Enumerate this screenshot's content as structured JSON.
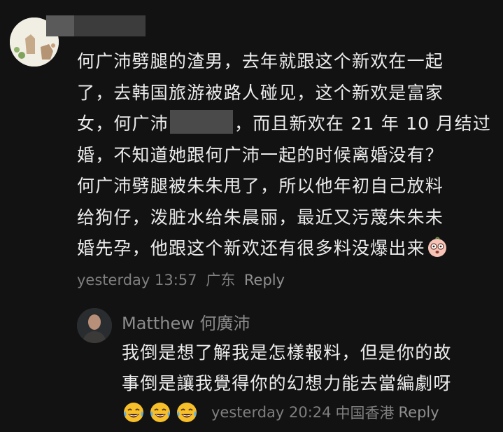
{
  "comment": {
    "lines": [
      "何广沛劈腿的渣男，去年就跟这个新欢在一起",
      "了，去韩国旅游被路人碰见，这个新欢是富家",
      "女，何广沛",
      "，而且新欢在 21 年 10 月结过",
      "婚，不知道她跟何广沛一起的时候离婚没有？",
      "何广沛劈腿被朱朱甩了，所以他年初自己放料",
      "给狗仔，泼脏水给朱晨丽，最近又污蔑朱朱未",
      "婚先孕，他跟这个新欢还有很多料没爆出来"
    ],
    "time": "yesterday 13:57",
    "location": "广东",
    "reply_label": "Reply",
    "emoji_end": "shocked-face-icon"
  },
  "reply": {
    "author": "Matthew 何廣沛",
    "lines": [
      "我倒是想了解我是怎樣報料，但是你的故",
      "事倒是讓我覺得你的幻想力能去當編劇呀"
    ],
    "emojis": [
      "tears-of-joy-icon",
      "tears-of-joy-icon",
      "tears-of-joy-icon"
    ],
    "time": "yesterday 20:24",
    "location": "中国香港",
    "reply_label": "Reply"
  },
  "colors": {
    "background": "#121212",
    "text": "#ececec",
    "meta": "#7f7f7f"
  }
}
